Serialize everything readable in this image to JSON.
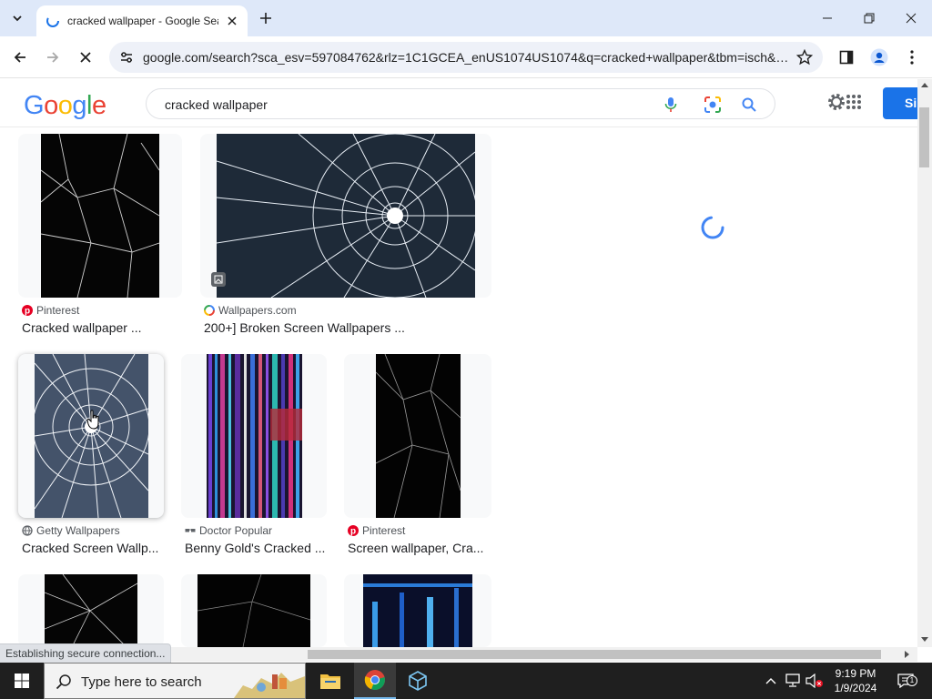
{
  "browser": {
    "tab": {
      "title": "cracked wallpaper - Google Search"
    },
    "url": "google.com/search?sca_esv=597084762&rlz=1C1GCEA_enUS1074US1074&q=cracked+wallpaper&tbm=isch&source=lnms"
  },
  "google": {
    "logo": [
      "G",
      "o",
      "o",
      "g",
      "l",
      "e"
    ],
    "query": "cracked wallpaper",
    "signin_label": "Si"
  },
  "results": [
    {
      "source": "Pinterest",
      "title": "Cracked wallpaper ..."
    },
    {
      "source": "Wallpapers.com",
      "title": "200+] Broken Screen Wallpapers ..."
    },
    {
      "source": "Getty Wallpapers",
      "title": "Cracked Screen Wallp..."
    },
    {
      "source": "Doctor Popular",
      "title": "Benny Gold's Cracked ..."
    },
    {
      "source": "Pinterest",
      "title": "Screen wallpaper, Cra..."
    }
  ],
  "status_text": "Establishing secure connection...",
  "taskbar": {
    "search_placeholder": "Type here to search",
    "time": "9:19 PM",
    "date": "1/9/2024",
    "notification_count": "1"
  },
  "colors": {
    "google_blue": "#4285F4",
    "google_red": "#EA4335",
    "google_yellow": "#FBBC05",
    "google_green": "#34A853",
    "signin_blue": "#1a73e8"
  }
}
